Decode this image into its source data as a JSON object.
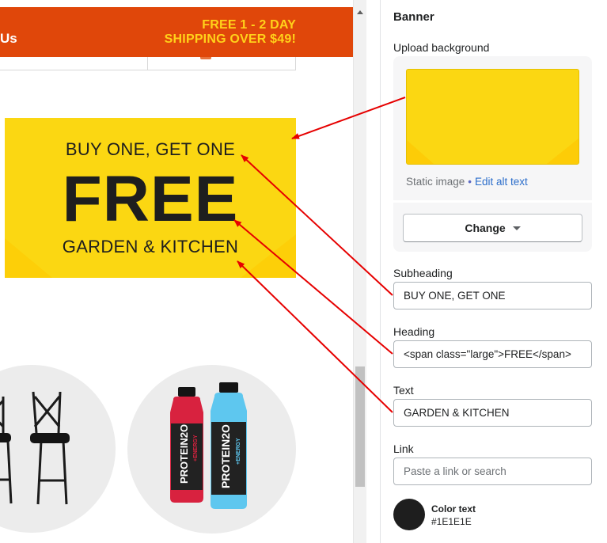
{
  "promo": {
    "left_text": "Us",
    "right_line1": "FREE 1 - 2 DAY",
    "right_line2": "SHIPPING OVER $49!"
  },
  "banner": {
    "subheading": "BUY ONE, GET ONE",
    "heading": "FREE",
    "text": "GARDEN & KITCHEN",
    "background_color": "#FBD712"
  },
  "products": {
    "bottle_brand": "PROTEIN2O",
    "bottle_left_flavor": "+ENERGY",
    "bottle_right_flavor": "+ENERGY"
  },
  "panel": {
    "title": "Banner",
    "upload": {
      "label": "Upload background",
      "static_label": "Static image",
      "separator": "•",
      "alt_link": "Edit alt text",
      "change_button": "Change"
    },
    "subheading": {
      "label": "Subheading",
      "value": "BUY ONE, GET ONE"
    },
    "heading": {
      "label": "Heading",
      "value": "<span class=\"large\">FREE</span>"
    },
    "text": {
      "label": "Text",
      "value": "GARDEN & KITCHEN"
    },
    "link": {
      "label": "Link",
      "placeholder": "Paste a link or search"
    },
    "color_text": {
      "label": "Color text",
      "value": "#1E1E1E"
    }
  },
  "colors": {
    "promo_bg": "#E0470A",
    "promo_accent": "#FFD21A",
    "annotation_arrow": "#E60000",
    "link": "#2C6ECB"
  }
}
